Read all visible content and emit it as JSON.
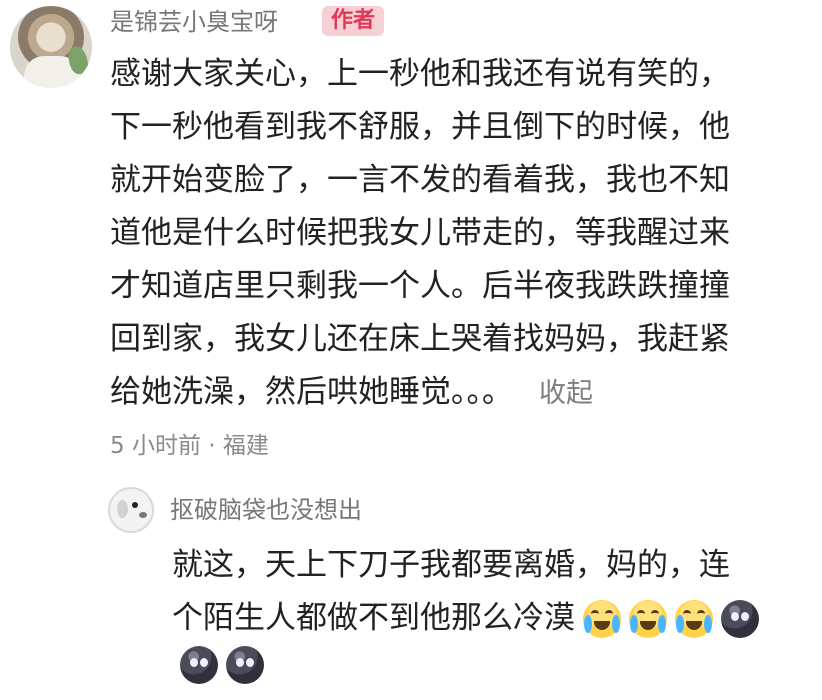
{
  "comment": {
    "username": "是锦芸小臭宝呀",
    "badge": "作者",
    "lines": [
      "感谢大家关心，上一秒他和我还有说有笑的，",
      "下一秒他看到我不舒服，并且倒下的时候，他",
      "就开始变脸了，一言不发的看着我，我也不知",
      "道他是什么时候把我女儿带走的，等我醒过来",
      "才知道店里只剩我一个人。后半夜我跌跌撞撞",
      "回到家，我女儿还在床上哭着找妈妈，我赶紧",
      "给她洗澡，然后哄她睡觉。。。"
    ],
    "collapse_label": "收起",
    "meta": "5 小时前 · 福建"
  },
  "reply": {
    "username": "抠破脑袋也没想出",
    "line1": "就这，天上下刀子我都要离婚，妈的，连",
    "line2": "个陌生人都做不到他那么冷漠",
    "emojis_line2": [
      "crying-face-icon",
      "crying-face-icon",
      "crying-face-icon",
      "dark-face-icon"
    ],
    "emojis_line3": [
      "dark-face-icon",
      "dark-face-icon"
    ]
  }
}
